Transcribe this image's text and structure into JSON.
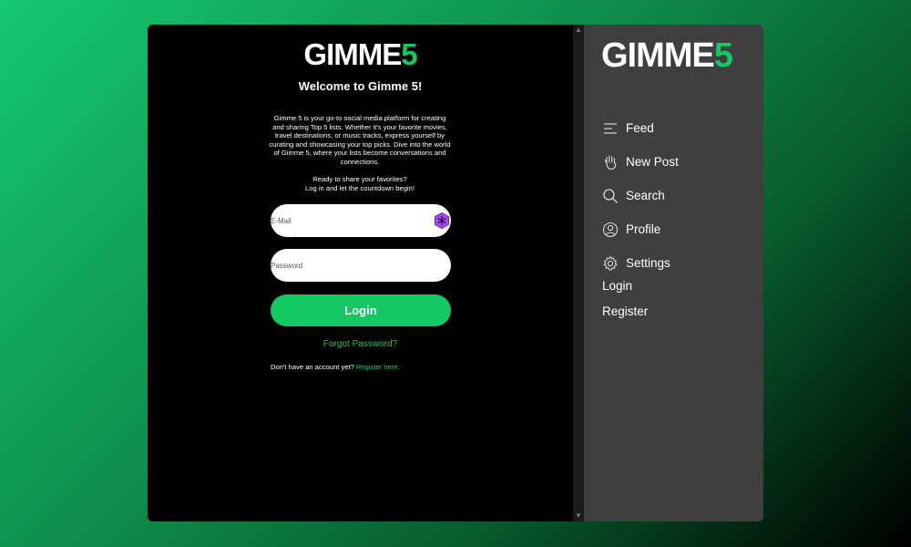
{
  "brand": {
    "logo_main": "GIMME",
    "logo_accent": "5",
    "accent_color": "#14c864"
  },
  "auth": {
    "welcome": "Welcome to Gimme 5!",
    "intro": "Gimme 5 is your go-to social media platform for creating and sharing Top 5 lists. Whether it's your favorite movies, travel destinations, or music tracks, express yourself by curating and showcasing your top picks. Dive into the world of Gimme 5, where your lists become conversations and connections.",
    "ready_line1": "Ready to share your favorites?",
    "ready_line2": "Log in and let the countdown begin!",
    "email_placeholder": "E-Mail",
    "password_placeholder": "Password",
    "login_label": "Login",
    "forgot_label": "Forgot Password?",
    "no_account_text": "Don't have an account yet?",
    "register_link": "Register here."
  },
  "sidebar": {
    "items": [
      {
        "label": "Feed",
        "icon": "feed-icon"
      },
      {
        "label": "New Post",
        "icon": "hand-icon"
      },
      {
        "label": "Search",
        "icon": "search-icon"
      },
      {
        "label": "Profile",
        "icon": "profile-icon"
      },
      {
        "label": "Settings",
        "icon": "gear-icon"
      }
    ],
    "login_label": "Login",
    "register_label": "Register"
  }
}
